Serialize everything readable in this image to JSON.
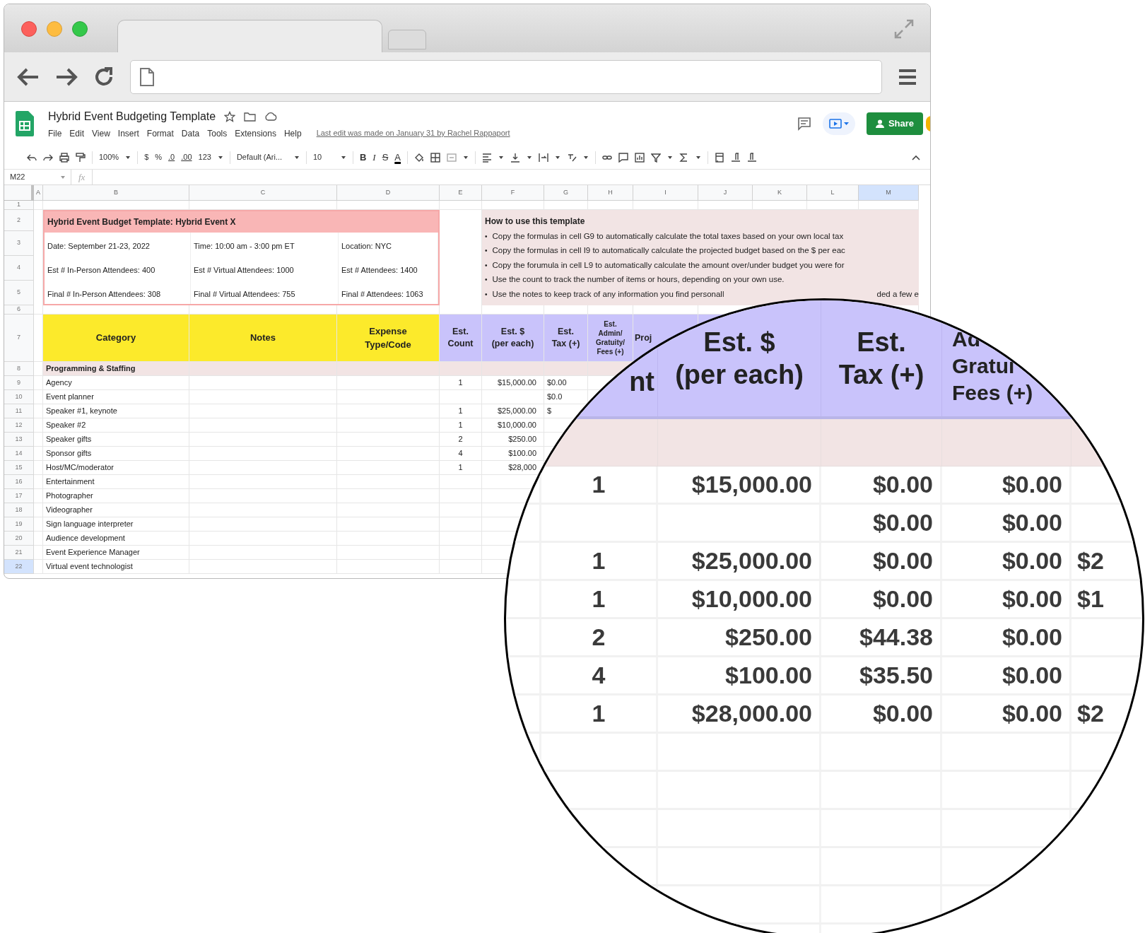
{
  "app": {
    "doc_title": "Hybrid Event Budgeting Template",
    "menus": [
      "File",
      "Edit",
      "View",
      "Insert",
      "Format",
      "Data",
      "Tools",
      "Extensions",
      "Help"
    ],
    "last_edit": "Last edit was made on January 31 by Rachel Rappaport",
    "share": "Share"
  },
  "toolbar": {
    "zoom": "100%",
    "currency": "$",
    "percent": "%",
    "decrease_decimal": ".0",
    "increase_decimal": ".00",
    "number_format": "123",
    "font": "Default (Ari...",
    "font_size": "10",
    "format_letters": [
      "B",
      "I",
      "S",
      "A"
    ]
  },
  "formula_bar": {
    "cell_ref": "M22",
    "fx": "fx"
  },
  "column_headers": [
    {
      "label": "A",
      "selected": false
    },
    {
      "label": "B",
      "selected": false
    },
    {
      "label": "C",
      "selected": false
    },
    {
      "label": "D",
      "selected": false
    },
    {
      "label": "E",
      "selected": false
    },
    {
      "label": "F",
      "selected": false
    },
    {
      "label": "G",
      "selected": false
    },
    {
      "label": "H",
      "selected": false
    },
    {
      "label": "I",
      "selected": false
    },
    {
      "label": "J",
      "selected": false
    },
    {
      "label": "K",
      "selected": false
    },
    {
      "label": "L",
      "selected": false
    },
    {
      "label": "M",
      "selected": true
    }
  ],
  "row_numbers": [
    {
      "label": "1",
      "selected": false
    },
    {
      "label": "2",
      "selected": false
    },
    {
      "label": "3",
      "selected": false
    },
    {
      "label": "4",
      "selected": false
    },
    {
      "label": "5",
      "selected": false
    },
    {
      "label": "6",
      "selected": false
    },
    {
      "label": "7",
      "selected": false
    },
    {
      "label": "8",
      "selected": false
    },
    {
      "label": "9",
      "selected": false
    },
    {
      "label": "10",
      "selected": false
    },
    {
      "label": "11",
      "selected": false
    },
    {
      "label": "12",
      "selected": false
    },
    {
      "label": "13",
      "selected": false
    },
    {
      "label": "14",
      "selected": false
    },
    {
      "label": "15",
      "selected": false
    },
    {
      "label": "16",
      "selected": false
    },
    {
      "label": "17",
      "selected": false
    },
    {
      "label": "18",
      "selected": false
    },
    {
      "label": "19",
      "selected": false
    },
    {
      "label": "20",
      "selected": false
    },
    {
      "label": "21",
      "selected": false
    },
    {
      "label": "22",
      "selected": true
    }
  ],
  "event_box": {
    "title": "Hybrid Event Budget Template: Hybrid Event X",
    "rows": [
      [
        "Date: September 21-23, 2022",
        "Time: 10:00 am - 3:00 pm ET",
        "Location: NYC"
      ],
      [
        "Est # In-Person Attendees: 400",
        "Est # Virtual Attendees: 1000",
        "Est # Attendees: 1400"
      ],
      [
        "Final # In-Person Attendees: 308",
        "Final # Virtual Attendees: 755",
        "Final # Attendees: 1063"
      ]
    ]
  },
  "instructions": {
    "title": "How to use this template",
    "bullets": [
      {
        "marker": "•",
        "text": "Copy the formulas in cell G9 to automatically calculate the total taxes based on your own local tax"
      },
      {
        "marker": "•",
        "text": "Copy the formulas in cell I9 to automatically calculate the projected budget based on the $ per eac"
      },
      {
        "marker": "•",
        "text": "Copy the forumula in cell L9 to automatically calculate the amount over/under budget you were for"
      },
      {
        "marker": "•",
        "text": "Use the count to track the number of items or hours, depending on your own use."
      },
      {
        "marker": "•",
        "text": "Use the notes to keep track of any information you find personall",
        "tail": "ded a few e"
      }
    ]
  },
  "table": {
    "headers": [
      "Category",
      "Notes",
      "Expense\nType/Code",
      "Est.\nCount",
      "Est. $\n(per each)",
      "Est.\nTax (+)",
      "Est.\nAdmin/\nGratuity/\nFees (+)",
      "Proj"
    ],
    "section": "Programming & Staffing",
    "rows": [
      {
        "category": "Agency",
        "count": "1",
        "cost": "$15,000.00",
        "tax": "$0.00"
      },
      {
        "category": "Event planner",
        "tax": "$0.0"
      },
      {
        "category": "Speaker #1, keynote",
        "count": "1",
        "cost": "$25,000.00",
        "tax": "$"
      },
      {
        "category": "Speaker #2",
        "count": "1",
        "cost": "$10,000.00"
      },
      {
        "category": "Speaker gifts",
        "count": "2",
        "cost": "$250.00"
      },
      {
        "category": "Sponsor gifts",
        "count": "4",
        "cost": "$100.00"
      },
      {
        "category": "Host/MC/moderator",
        "count": "1",
        "cost": "$28,000"
      },
      {
        "category": "Entertainment"
      },
      {
        "category": "Photographer"
      },
      {
        "category": "Videographer"
      },
      {
        "category": "Sign language interpreter"
      },
      {
        "category": "Audience development"
      },
      {
        "category": "Event Experience Manager"
      },
      {
        "category": "Virtual event technologist"
      }
    ]
  },
  "magnifier": {
    "headers": [
      [
        "nt"
      ],
      [
        "Est. $",
        "(per each)"
      ],
      [
        "Est.",
        "Tax (+)"
      ],
      [
        "Ad",
        "Gratui",
        "Fees (+)"
      ]
    ],
    "rows": [
      [
        "1",
        "$15,000.00",
        "$0.00",
        "$0.00",
        ""
      ],
      [
        "",
        "",
        "$0.00",
        "$0.00",
        ""
      ],
      [
        "1",
        "$25,000.00",
        "$0.00",
        "$0.00",
        "$2"
      ],
      [
        "1",
        "$10,000.00",
        "$0.00",
        "$0.00",
        "$1"
      ],
      [
        "2",
        "$250.00",
        "$44.38",
        "$0.00",
        ""
      ],
      [
        "4",
        "$100.00",
        "$35.50",
        "$0.00",
        ""
      ],
      [
        "1",
        "$28,000.00",
        "$0.00",
        "$0.00",
        "$2"
      ]
    ]
  }
}
